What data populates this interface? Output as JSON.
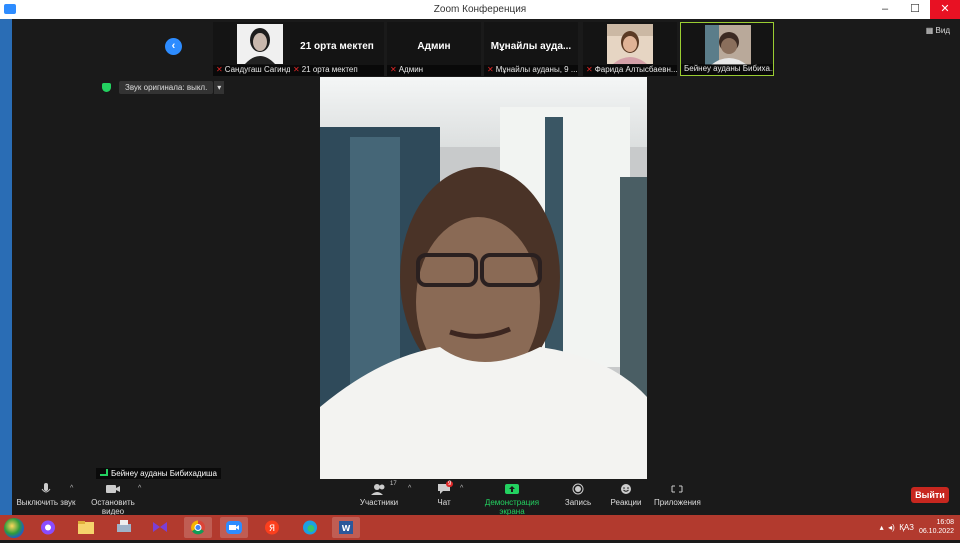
{
  "window": {
    "title": "Zoom Конференция",
    "minimize": "–",
    "maximize": "☐",
    "close": "✕"
  },
  "strip": {
    "nav_left": "‹",
    "view_label": "Вид",
    "tiles": [
      {
        "name": "Сандугаш Сагиндико...",
        "big": "",
        "muted": true,
        "photo": true
      },
      {
        "name": "21 орта мектеп",
        "big": "21 орта мектеп",
        "muted": true,
        "photo": false
      },
      {
        "name": "Админ",
        "big": "Админ",
        "muted": true,
        "photo": false
      },
      {
        "name": "Мұнайлы ауданы, 9 ...",
        "big": "Мұнайлы ауда...",
        "muted": true,
        "photo": false
      },
      {
        "name": "Фарида Алтысбаевн...",
        "big": "",
        "muted": true,
        "photo": true
      },
      {
        "name": "Бейнеу ауданы Бибиха...",
        "big": "",
        "muted": false,
        "photo": true
      }
    ]
  },
  "audio": {
    "label": "Звук оригинала: выкл.",
    "dropdown": "▾"
  },
  "speaker": {
    "name": "Бейнеу ауданы Бибихадиша"
  },
  "toolbar": {
    "mute": "Выключить звук",
    "video": "Остановить видео",
    "participants": "Участники",
    "participants_count": "17",
    "chat": "Чат",
    "chat_badge": "9",
    "share": "Демонстрация экрана",
    "record": "Запись",
    "reactions": "Реакции",
    "apps": "Приложения",
    "exit": "Выйти"
  },
  "taskbar": {
    "lang": "ҚАЗ",
    "time": "16:08",
    "date": "06.10.2022"
  },
  "colors": {
    "accent": "#2d8cff",
    "mute_red": "#e02828",
    "share_green": "#23d160",
    "exit_red": "#c7271f"
  }
}
